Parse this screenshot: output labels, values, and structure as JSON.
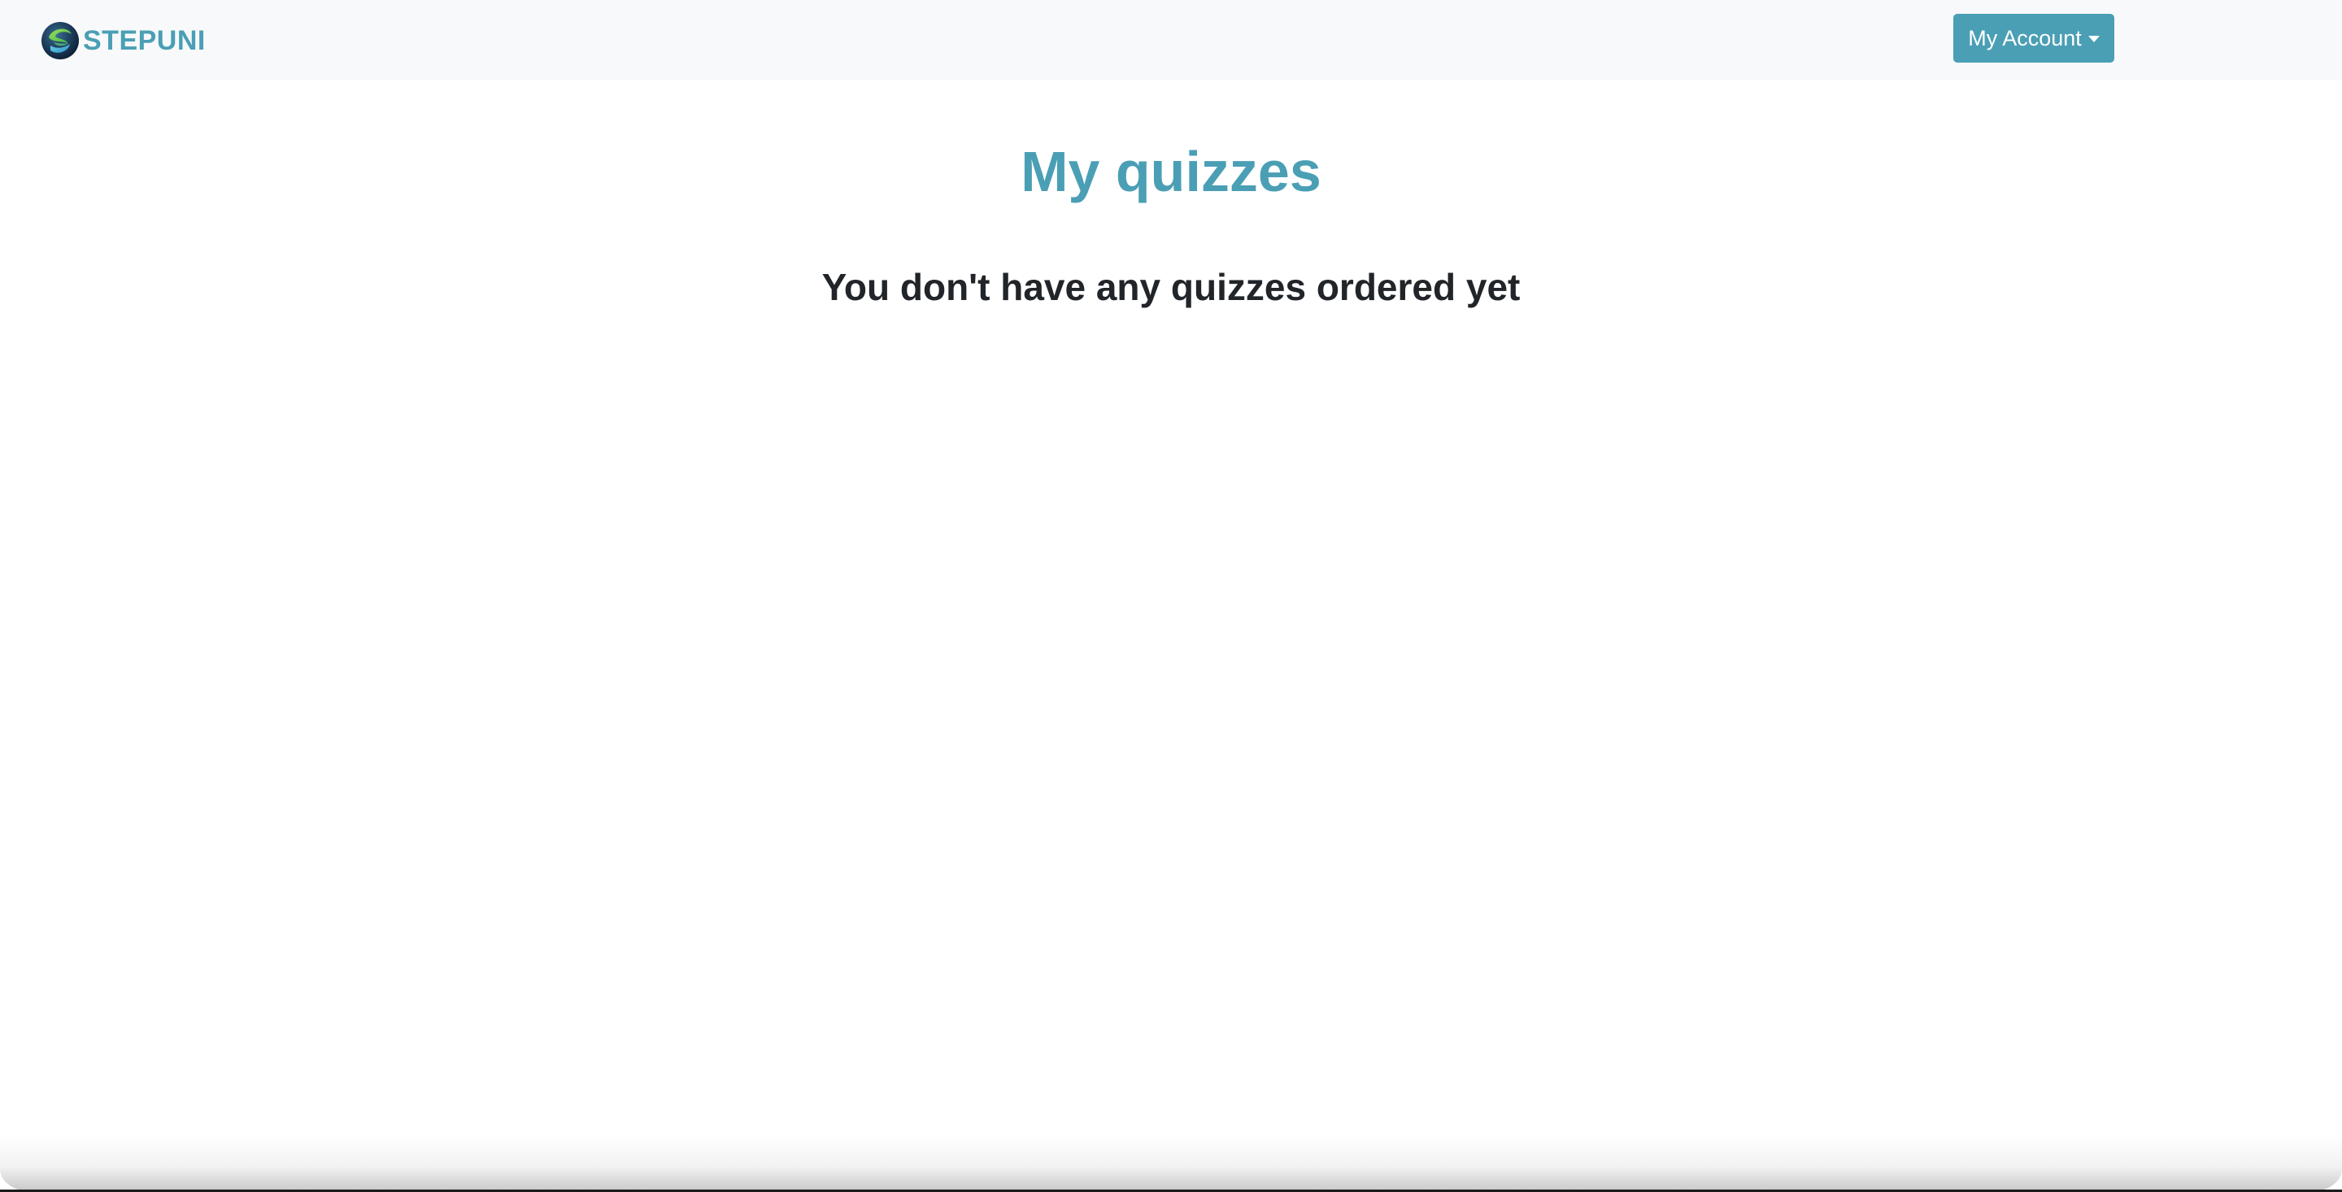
{
  "navbar": {
    "brand": {
      "logo_icon": "globe-s-logo-icon",
      "name": "STEPUNI"
    },
    "account_menu": {
      "label": "My Account",
      "caret_icon": "caret-down-icon"
    }
  },
  "main": {
    "title": "My quizzes",
    "empty_message": "You don't have any quizzes ordered yet"
  },
  "colors": {
    "accent": "#4a9fb5",
    "navbar_bg": "#f8f9fa",
    "text_dark": "#212529",
    "background": "#ffffff"
  }
}
